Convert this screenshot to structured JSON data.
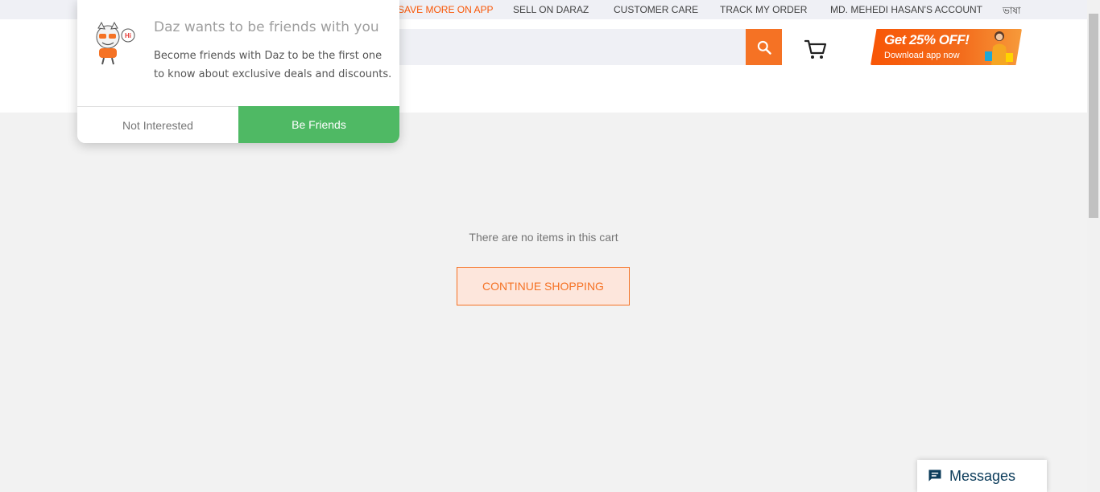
{
  "topbar": {
    "links": [
      {
        "label": "SAVE MORE ON APP",
        "name": "topbar-save-more-on-app"
      },
      {
        "label": "SELL ON DARAZ",
        "name": "topbar-sell-on-daraz"
      },
      {
        "label": "CUSTOMER CARE",
        "name": "topbar-customer-care"
      },
      {
        "label": "TRACK MY ORDER",
        "name": "topbar-track-my-order"
      },
      {
        "label": "MD. MEHEDI HASAN'S ACCOUNT",
        "name": "topbar-account"
      },
      {
        "label": "ভাষা",
        "name": "topbar-language"
      }
    ]
  },
  "header": {
    "search": {
      "value": "",
      "placeholder": ""
    },
    "search_icon": "search-icon",
    "cart_icon": "cart-icon",
    "promo": {
      "headline": "Get 25% OFF!",
      "sub": "Download app now"
    }
  },
  "cart": {
    "empty_message": "There are no items in this cart",
    "continue_label": "CONTINUE SHOPPING"
  },
  "popup": {
    "title": "Daz wants to be friends with you",
    "body": "Become friends with Daz to be the first one to know about exclusive deals and discounts.",
    "mascot_badge": "Hi",
    "not_interested_label": "Not Interested",
    "be_friends_label": "Be Friends"
  },
  "messages": {
    "label": "Messages",
    "icon": "chat-icon"
  },
  "colors": {
    "accent": "#f57224",
    "topbar_accent": "#f85606",
    "friends_green": "#4fb964",
    "page_bg": "#f2f2f2",
    "messages_text": "#0c3c5b"
  }
}
